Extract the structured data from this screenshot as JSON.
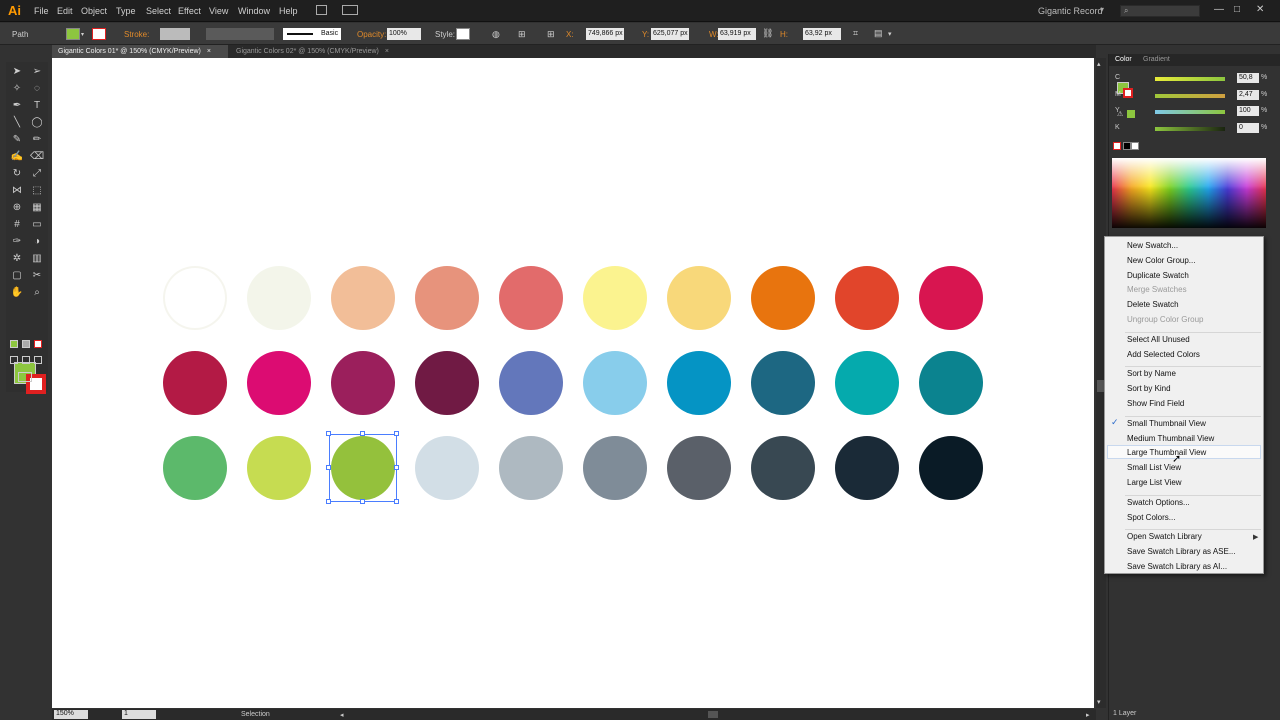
{
  "app": {
    "logo": "Ai",
    "menus": [
      "File",
      "Edit",
      "Object",
      "Type",
      "Select",
      "Effect",
      "View",
      "Window",
      "Help"
    ],
    "workspace": "Gigantic Record",
    "window_controls": [
      "—",
      "□",
      "✕"
    ]
  },
  "control_bar": {
    "object_type": "Path",
    "stroke_label": "Stroke:",
    "brush_label": "Basic",
    "opacity_label": "Opacity:",
    "opacity_value": "100%",
    "style_label": "Style:",
    "x_label": "X:",
    "x_value": "749,866 px",
    "y_label": "Y:",
    "y_value": "625,077 px",
    "w_label": "W:",
    "w_value": "63,919 px",
    "h_label": "H:",
    "h_value": "63,92 px"
  },
  "tabs": [
    {
      "label": "Gigantic Colors 01* @ 150% (CMYK/Preview)",
      "close": "×"
    },
    {
      "label": "Gigantic Colors 02* @ 150% (CMYK/Preview)",
      "close": "×"
    }
  ],
  "tools": {
    "fill_color": "#8dc63f",
    "stroke_color": "#e02020"
  },
  "swatches": {
    "rows": [
      [
        "#ffffff",
        "#f3f5ea",
        "#f2be98",
        "#e7937c",
        "#e26b6b",
        "#fbf38f",
        "#f8d87a",
        "#e8740e",
        "#e1452b",
        "#d81550"
      ],
      [
        "#b31a45",
        "#dc0c72",
        "#9b1f5c",
        "#701a44",
        "#6377bb",
        "#88cdeb",
        "#0594c4",
        "#1d6782",
        "#05aaad",
        "#0b838f"
      ],
      [
        "#5cb96b",
        "#c6dc51",
        "#94c13c",
        "#d2dee6",
        "#aeb9c1",
        "#7f8c98",
        "#5a6069",
        "#384852",
        "#1a2a37",
        "#0a1b26"
      ]
    ],
    "selected_row": 2,
    "selected_col": 2
  },
  "color_panel": {
    "tabs": [
      "Color",
      "Gradient"
    ],
    "channels": [
      {
        "label": "C",
        "value": "50,8",
        "unit": "%",
        "bar": "#8dc63f"
      },
      {
        "label": "M",
        "value": "2,47",
        "unit": "%",
        "bar": "#c8c03a"
      },
      {
        "label": "Y",
        "value": "100",
        "unit": "%",
        "bar": "#6bb3d8"
      },
      {
        "label": "K",
        "value": "0",
        "unit": "%",
        "bar": "#7aa33a"
      }
    ]
  },
  "context_menu": {
    "groups": [
      [
        {
          "label": "New Swatch...",
          "disabled": false
        },
        {
          "label": "New Color Group...",
          "disabled": false
        },
        {
          "label": "Duplicate Swatch",
          "disabled": false
        },
        {
          "label": "Merge Swatches",
          "disabled": true
        },
        {
          "label": "Delete Swatch",
          "disabled": false
        },
        {
          "label": "Ungroup Color Group",
          "disabled": true
        }
      ],
      [
        {
          "label": "Select All Unused",
          "disabled": false
        },
        {
          "label": "Add Selected Colors",
          "disabled": false
        }
      ],
      [
        {
          "label": "Sort by Name",
          "disabled": false
        },
        {
          "label": "Sort by Kind",
          "disabled": false
        },
        {
          "label": "Show Find Field",
          "disabled": false
        }
      ],
      [
        {
          "label": "Small Thumbnail View",
          "disabled": false,
          "checked": true
        },
        {
          "label": "Medium Thumbnail View",
          "disabled": false
        },
        {
          "label": "Large Thumbnail View",
          "disabled": false,
          "hovered": true
        },
        {
          "label": "Small List View",
          "disabled": false
        },
        {
          "label": "Large List View",
          "disabled": false
        }
      ],
      [
        {
          "label": "Swatch Options...",
          "disabled": false
        },
        {
          "label": "Spot Colors...",
          "disabled": false
        }
      ],
      [
        {
          "label": "Open Swatch Library",
          "disabled": false,
          "submenu": true
        },
        {
          "label": "Save Swatch Library as ASE...",
          "disabled": false
        },
        {
          "label": "Save Swatch Library as AI...",
          "disabled": false
        }
      ]
    ]
  },
  "status": {
    "zoom": "150%",
    "artboard": "1",
    "tool": "Selection"
  },
  "layers": {
    "count_label": "1 Layer"
  }
}
